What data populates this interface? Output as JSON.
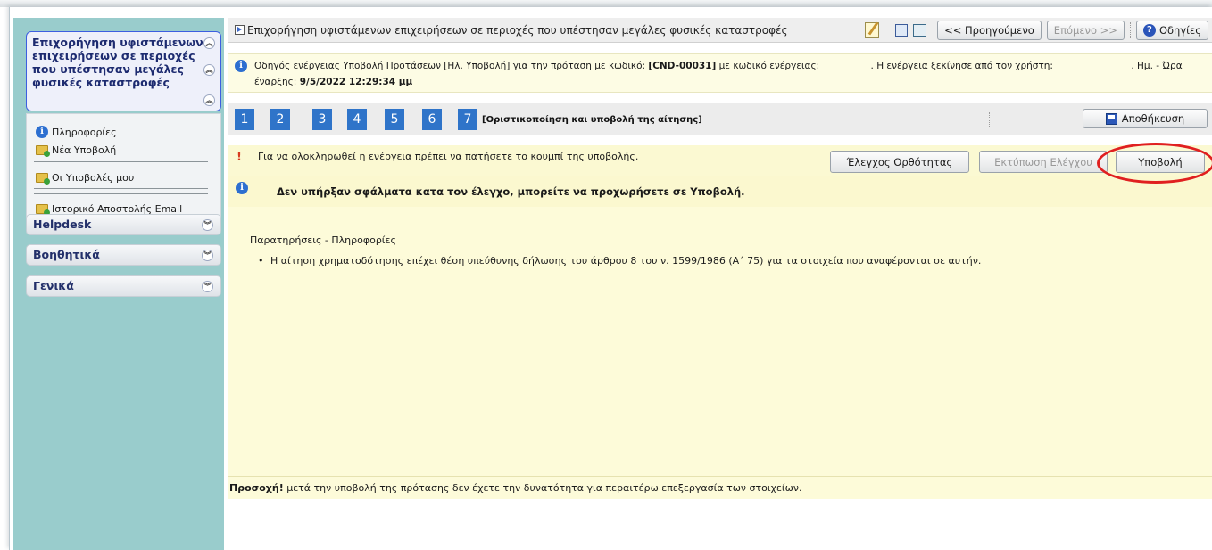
{
  "sidebar": {
    "header_lines": [
      "Επιχορήγηση υφιστάμενων",
      "επιχειρήσεων σε περιοχές",
      "που υπέστησαν μεγάλες",
      "φυσικές καταστροφές"
    ],
    "items": [
      {
        "label": "Πληροφορίες",
        "icon": "info-icon"
      },
      {
        "label": "Νέα Υποβολή",
        "icon": "folder-add-icon"
      },
      {
        "label": "Οι Υποβολές μου",
        "icon": "folder-add-icon"
      },
      {
        "label": "Ιστορικό Αποστολής Email",
        "icon": "folder-add-icon"
      }
    ],
    "groups": [
      "Helpdesk",
      "Βοηθητικά",
      "Γενικά"
    ]
  },
  "titlebar": {
    "title": "Επιχορήγηση υφιστάμενων επιχειρήσεων σε περιοχές που υπέστησαν μεγάλες φυσικές καταστροφές",
    "prev_label": "<< Προηγούμενο",
    "next_label": "Επόμενο >>",
    "help_label": "Οδηγίες"
  },
  "infobar": {
    "part1": "Οδηγός ενέργειας Υποβολή Προτάσεων [Ηλ. Υποβολή] για την πρόταση με κωδικό: ",
    "code": "[CND-00031]",
    "part2": " με κωδικό ενέργειας: ",
    "part3": ". Η ενέργεια ξεκίνησε από τον χρήστη: ",
    "part4": ". Ημ. - Ώρα",
    "start_label": "έναρξης: ",
    "start_value": "9/5/2022 12:29:34 μμ"
  },
  "steps": {
    "numbers": [
      "1",
      "2",
      "3",
      "4",
      "5",
      "6",
      "7"
    ],
    "current_label": "[Οριστικοποίηση και υποβολή της αίτησης]",
    "save_label": "Αποθήκευση"
  },
  "content": {
    "warning": "Για να ολοκληρωθεί η ενέργεια πρέπει να πατήσετε το κουμπί της υποβολής.",
    "check_button": "Έλεγχος Ορθότητας",
    "print_button": "Εκτύπωση Ελέγχου",
    "submit_button": "Υποβολή",
    "ok_message": "Δεν υπήρξαν σφάλματα κατα τον έλεγχο, μπορείτε να προχωρήσετε σε Υποβολή.",
    "notes_title": "Παρατηρήσεις - Πληροφορίες",
    "notes": [
      "Η αίτηση χρηματοδότησης επέχει θέση υπεύθυνης δήλωσης του άρθρου 8 του ν. 1599/1986 (Α΄ 75) για τα στοιχεία που αναφέρονται σε αυτήν."
    ]
  },
  "footer": {
    "bold": "Προσοχή!",
    "text": " μετά την υποβολή της πρότασης δεν έχετε την δυνατότητα για περαιτέρω επεξεργασία των στοιχείων."
  },
  "colors": {
    "sidebar_bg": "#99cccc",
    "step_blue": "#2f74c9",
    "highlight_circle": "#e02020",
    "content_bg": "#fdfbd9"
  }
}
